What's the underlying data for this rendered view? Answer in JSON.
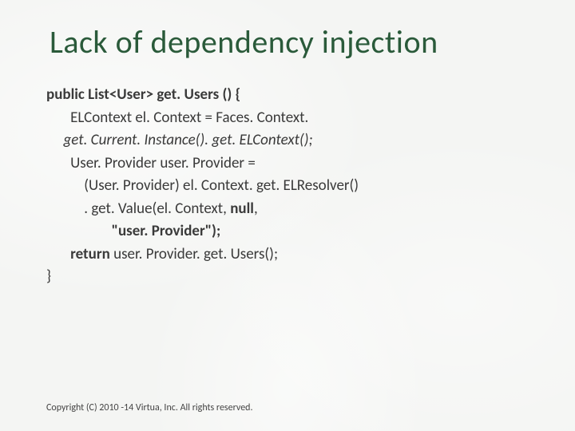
{
  "title": "Lack of dependency injection",
  "code": {
    "line1_a": "public List<User> get. Users () {",
    "line2_a": "       ELContext el. Context = Faces. Context.",
    "line3_a": "     get. Current. Instance(). get. ELContext();",
    "line4_a": "       User. Provider user. Provider =",
    "line5_a": "           (User. Provider) el. Context. get. ELResolver()",
    "line6_a": "           . get. Value(el. Context, ",
    "line6_b": "null",
    "line6_c": ",",
    "line7_a": "                   \"user. Provider\");",
    "line8_a": "       ",
    "line8_b": "return",
    "line8_c": " user. Provider. get. Users();",
    "line9_a": "}"
  },
  "footer": "Copyright (C) 2010 -14 Virtua, Inc. All rights reserved."
}
